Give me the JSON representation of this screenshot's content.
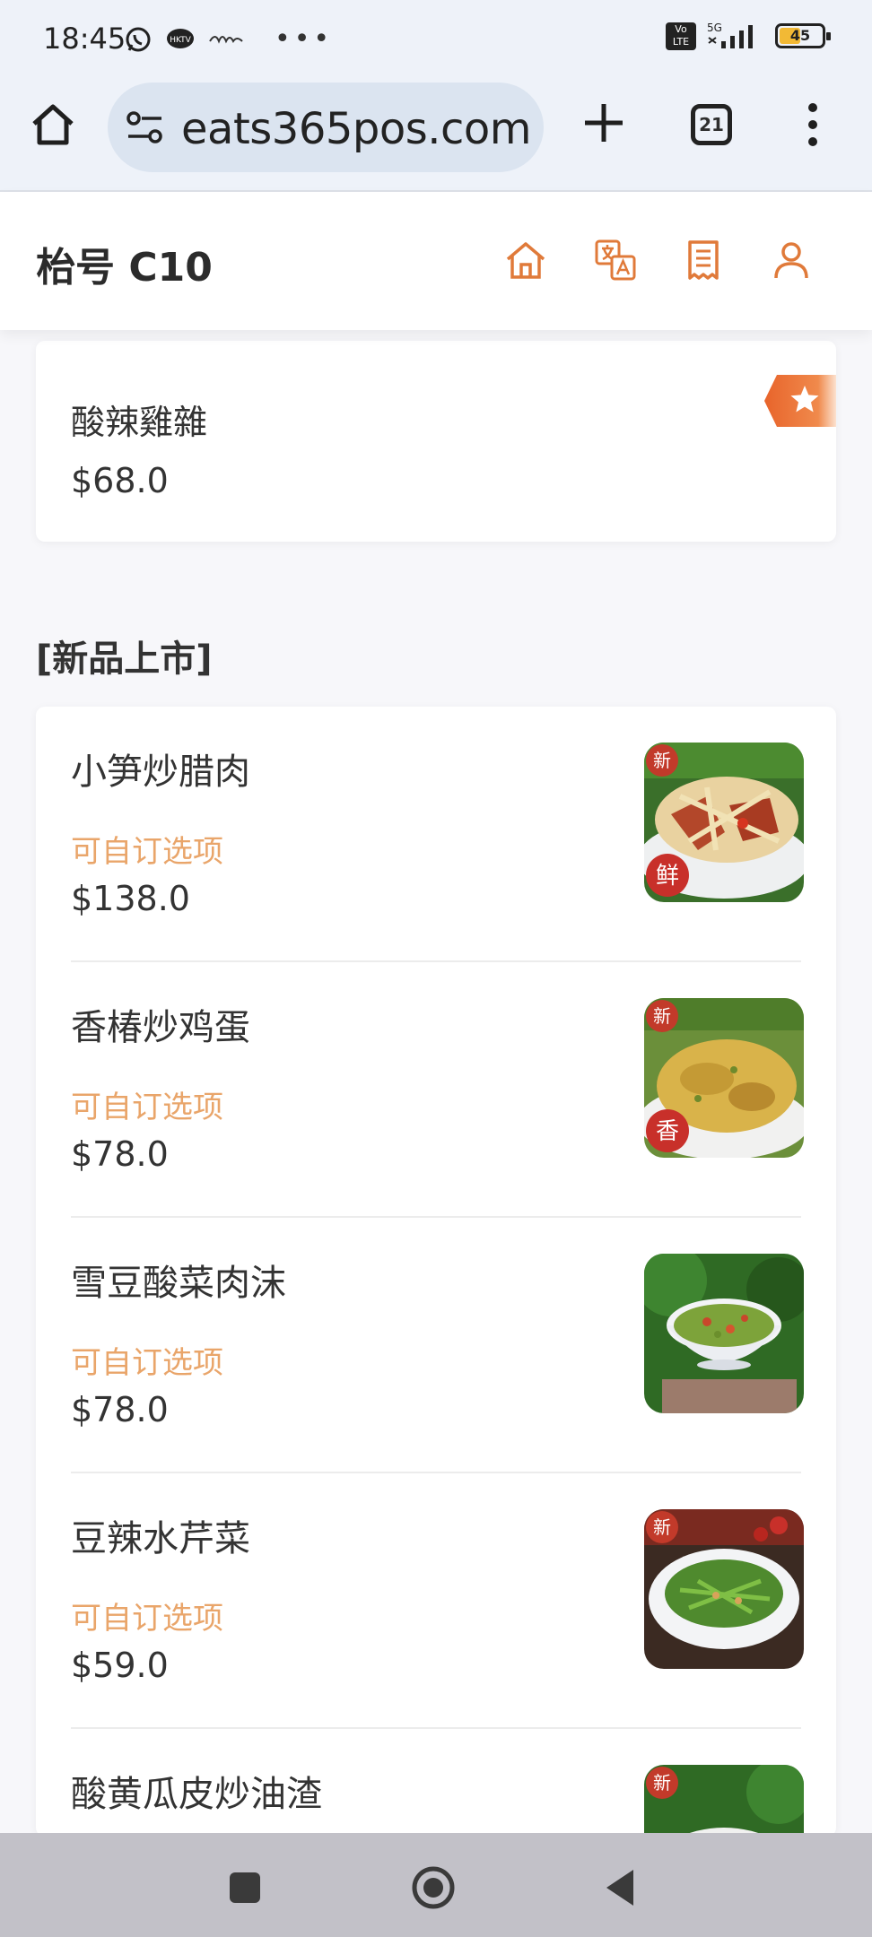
{
  "status_bar": {
    "time": "18:45",
    "network": "5G",
    "battery": "45"
  },
  "browser": {
    "url": "eats365pos.com",
    "tab_count": "21"
  },
  "header": {
    "title": "枱号 C10"
  },
  "featured_item": {
    "name": "酸辣雞雜",
    "price": "$68.0"
  },
  "section": {
    "title": "[新品上市]"
  },
  "items": [
    {
      "name": "小笋炒腊肉",
      "option": "可自订选项",
      "price": "$138.0"
    },
    {
      "name": "香椿炒鸡蛋",
      "option": "可自订选项",
      "price": "$78.0"
    },
    {
      "name": "雪豆酸菜肉沫",
      "option": "可自订选项",
      "price": "$78.0"
    },
    {
      "name": "豆辣水芹菜",
      "option": "可自订选项",
      "price": "$59.0"
    },
    {
      "name": "酸黄瓜皮炒油渣"
    }
  ],
  "colors": {
    "accent": "#e07a3a",
    "option_text": "#e9a56a"
  },
  "icons": [
    "home-icon",
    "translate-icon",
    "receipt-icon",
    "user-icon",
    "star-icon"
  ]
}
